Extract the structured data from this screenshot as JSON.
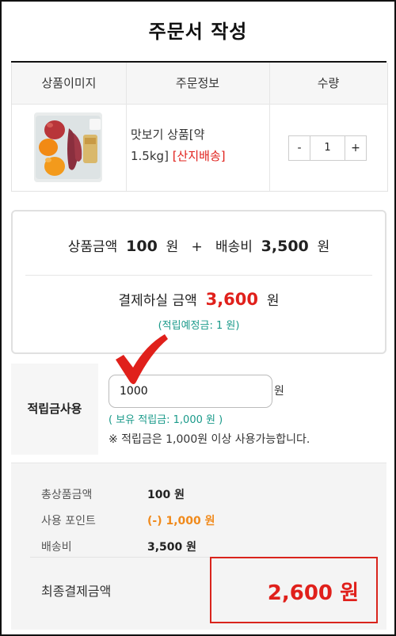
{
  "header": {
    "title": "주문서 작성"
  },
  "product_table": {
    "headers": [
      "상품이미지",
      "주문정보",
      "수량"
    ],
    "item": {
      "name_line1": "맛보기 상품[약",
      "name_line2": "1.5kg]",
      "shipping_tag": "[산지배송]",
      "quantity": "1",
      "minus_label": "-",
      "plus_label": "+"
    }
  },
  "summary": {
    "product_amount_label": "상품금액",
    "product_amount": "100",
    "won1": "원",
    "plus": "+",
    "shipping_label": "배송비",
    "shipping_amount": "3,500",
    "won2": "원",
    "pay_label": "결제하실 금액",
    "pay_amount": "3,600",
    "won3": "원",
    "expected_points": "(적립예정금: 1 원)"
  },
  "points": {
    "label": "적립금사용",
    "input_value": "1000",
    "unit": "원",
    "owned": "( 보유 적립금: 1,000 원 )",
    "note": "※ 적립금은 1,000원 이상 사용가능합니다."
  },
  "totals": {
    "rows": [
      {
        "label": "총상품금액",
        "value": "100 원"
      },
      {
        "label": "사용 포인트",
        "value": "(-) 1,000 원"
      },
      {
        "label": "배송비",
        "value": "3,500 원"
      }
    ],
    "final_label": "최종결제금액",
    "final_amount": "2,600 원"
  },
  "colors": {
    "accent_red": "#e0201b",
    "teal": "#1a9a8a",
    "orange": "#f08a1c"
  },
  "icons": [
    "checkmark-icon",
    "product-thumbnail"
  ]
}
